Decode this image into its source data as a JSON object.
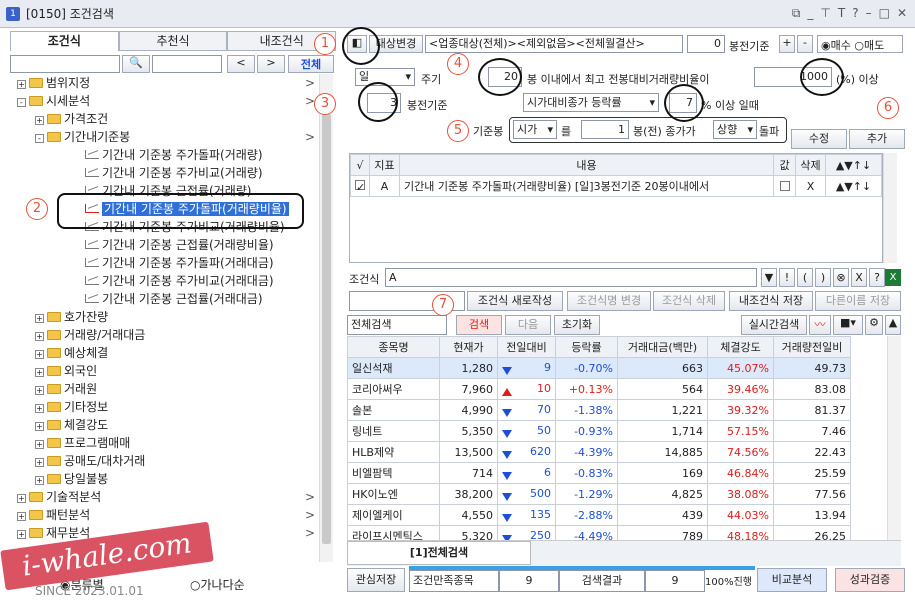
{
  "window": {
    "number": "1",
    "title": "[0150] 조건검색"
  },
  "left": {
    "tabs": [
      "조건식",
      "추천식",
      "내조건식"
    ],
    "search_placeholder": "",
    "nav_prev": "<",
    "nav_next": ">",
    "all_button": "전체",
    "tree": [
      {
        "type": "folder",
        "sign": "+",
        "label": "범위지정",
        "indent": 0
      },
      {
        "type": "folder",
        "sign": "-",
        "label": "시세분석",
        "indent": 0
      },
      {
        "type": "folder",
        "sign": "+",
        "label": "가격조건",
        "indent": 1
      },
      {
        "type": "folder",
        "sign": "-",
        "label": "기간내기준봉",
        "indent": 1
      },
      {
        "type": "item",
        "label": "기간내 기준봉 주가돌파(거래량)",
        "indent": 2
      },
      {
        "type": "item",
        "label": "기간내 기준봉 주가비교(거래량)",
        "indent": 2
      },
      {
        "type": "item",
        "label": "기간내 기준봉 근접률(거래량)",
        "indent": 2
      },
      {
        "type": "item",
        "label": "기간내 기준봉 주가돌파(거래량비율)",
        "indent": 2,
        "selected": true
      },
      {
        "type": "item",
        "label": "기간내 기준봉 주가비교(거래량비율)",
        "indent": 2
      },
      {
        "type": "item",
        "label": "기간내 기준봉 근접률(거래량비율)",
        "indent": 2
      },
      {
        "type": "item",
        "label": "기간내 기준봉 주가돌파(거래대금)",
        "indent": 2
      },
      {
        "type": "item",
        "label": "기간내 기준봉 주가비교(거래대금)",
        "indent": 2
      },
      {
        "type": "item",
        "label": "기간내 기준봉 근접률(거래대금)",
        "indent": 2
      },
      {
        "type": "folder",
        "sign": "+",
        "label": "호가잔량",
        "indent": 1
      },
      {
        "type": "folder",
        "sign": "+",
        "label": "거래량/거래대금",
        "indent": 1
      },
      {
        "type": "folder",
        "sign": "+",
        "label": "예상체결",
        "indent": 1
      },
      {
        "type": "folder",
        "sign": "+",
        "label": "외국인",
        "indent": 1
      },
      {
        "type": "folder",
        "sign": "+",
        "label": "거래원",
        "indent": 1
      },
      {
        "type": "folder",
        "sign": "+",
        "label": "기타정보",
        "indent": 1
      },
      {
        "type": "folder",
        "sign": "+",
        "label": "체결강도",
        "indent": 1
      },
      {
        "type": "folder",
        "sign": "+",
        "label": "프로그램매매",
        "indent": 1
      },
      {
        "type": "folder",
        "sign": "+",
        "label": "공매도/대차거래",
        "indent": 1
      },
      {
        "type": "folder",
        "sign": "+",
        "label": "당일불봉",
        "indent": 1
      },
      {
        "type": "folder",
        "sign": "+",
        "label": "기술적분석",
        "indent": 0
      },
      {
        "type": "folder",
        "sign": "+",
        "label": "패턴분석",
        "indent": 0
      },
      {
        "type": "folder",
        "sign": "+",
        "label": "재무분석",
        "indent": 0
      }
    ],
    "sort_options": [
      "분류별",
      "가나다순"
    ],
    "since": "SINCE 2023.01.01"
  },
  "watermark": "i-whale.com",
  "annotations": [
    "1",
    "2",
    "3",
    "4",
    "5",
    "6",
    "7"
  ],
  "condition": {
    "target_button": "대상변경",
    "target_text": "<업종대상(전체)><제외없음><전체월결산>",
    "base_count": "0",
    "base_label": "봉전기준",
    "plus": "+",
    "minus": "-",
    "buy": "매수",
    "sell": "매도",
    "period": "일",
    "period_label": "주기",
    "bars_value": "20",
    "bars_text": "봉 이내에서 최고 전봉대비거래량비율이",
    "ratio_value": "1000",
    "ratio_text": "(%) 이상",
    "base_bar": "3",
    "base_bar_label": "봉전기준",
    "mcap_select": "시가대비종가 등락률",
    "mcap_value": "7",
    "mcap_text": "% 이상 일때",
    "kijun_label": "기준봉",
    "kijun_select": "시가",
    "kijun_text1": "를",
    "kijun_value": "1",
    "kijun_text2": "봉(전) 종가가",
    "kijun_select2": "상향",
    "kijun_text3": "돌파",
    "edit_button": "수정",
    "add_button": "추가"
  },
  "list": {
    "headers": [
      "√",
      "지표",
      "내용",
      "값",
      "삭제",
      "▲▼↑↓"
    ],
    "rows": [
      {
        "check": true,
        "code": "A",
        "content": "기간내 기준봉 주가돌파(거래량비율) [일]3봉전기준 20봉이내에서",
        "value": "",
        "delete": "X",
        "arrows": "▲▼↑↓"
      }
    ]
  },
  "formula": {
    "label": "조건식",
    "value": "A",
    "buttons": [
      "▼",
      "!",
      "(",
      ")",
      "⊗",
      "X",
      "?"
    ]
  },
  "actions": {
    "new": "조건식 새로작성",
    "rename": "조건식명 변경",
    "delete": "조건식 삭제",
    "save": "내조건식 저장",
    "save_as": "다른이름 저장"
  },
  "search": {
    "scope": "전체검색",
    "search_btn": "검색",
    "next_btn": "다음",
    "reset_btn": "초기화",
    "realtime_btn": "실시간검색"
  },
  "results": {
    "headers": [
      "종목명",
      "현재가",
      "전일대비",
      "등락률",
      "거래대금(백만)",
      "체결강도",
      "거래량전일비"
    ],
    "rows": [
      {
        "name": "일신석재",
        "price": "1,280",
        "dir": "down",
        "change": "9",
        "rate": "-0.70%",
        "amount": "663",
        "strength": "45.07%",
        "vol": "49.73"
      },
      {
        "name": "코리아써우",
        "price": "7,960",
        "dir": "up",
        "change": "10",
        "rate": "+0.13%",
        "amount": "564",
        "strength": "39.46%",
        "vol": "83.08"
      },
      {
        "name": "솔본",
        "price": "4,990",
        "dir": "down",
        "change": "70",
        "rate": "-1.38%",
        "amount": "1,221",
        "strength": "39.32%",
        "vol": "81.37"
      },
      {
        "name": "링네트",
        "price": "5,350",
        "dir": "down",
        "change": "50",
        "rate": "-0.93%",
        "amount": "1,714",
        "strength": "57.15%",
        "vol": "7.46"
      },
      {
        "name": "HLB제약",
        "price": "13,500",
        "dir": "down",
        "change": "620",
        "rate": "-4.39%",
        "amount": "14,885",
        "strength": "74.56%",
        "vol": "22.43"
      },
      {
        "name": "비엘팜텍",
        "price": "714",
        "dir": "down",
        "change": "6",
        "rate": "-0.83%",
        "amount": "169",
        "strength": "46.84%",
        "vol": "25.59"
      },
      {
        "name": "HK이노엔",
        "price": "38,200",
        "dir": "down",
        "change": "500",
        "rate": "-1.29%",
        "amount": "4,825",
        "strength": "38.08%",
        "vol": "77.56"
      },
      {
        "name": "제이엘케이",
        "price": "4,550",
        "dir": "down",
        "change": "135",
        "rate": "-2.88%",
        "amount": "439",
        "strength": "44.03%",
        "vol": "13.94"
      },
      {
        "name": "라이프시멘틱스",
        "price": "5,320",
        "dir": "down",
        "change": "250",
        "rate": "-4.49%",
        "amount": "789",
        "strength": "48.18%",
        "vol": "26.25"
      }
    ]
  },
  "bottom": {
    "tab": "[1]전체검색",
    "interest": "관심저장",
    "cond_label": "조건만족종목",
    "cond_count": "9",
    "result_label": "검색결과",
    "result_count": "9",
    "progress": "100%진행",
    "compare": "비교분석",
    "verify": "성과검증"
  }
}
